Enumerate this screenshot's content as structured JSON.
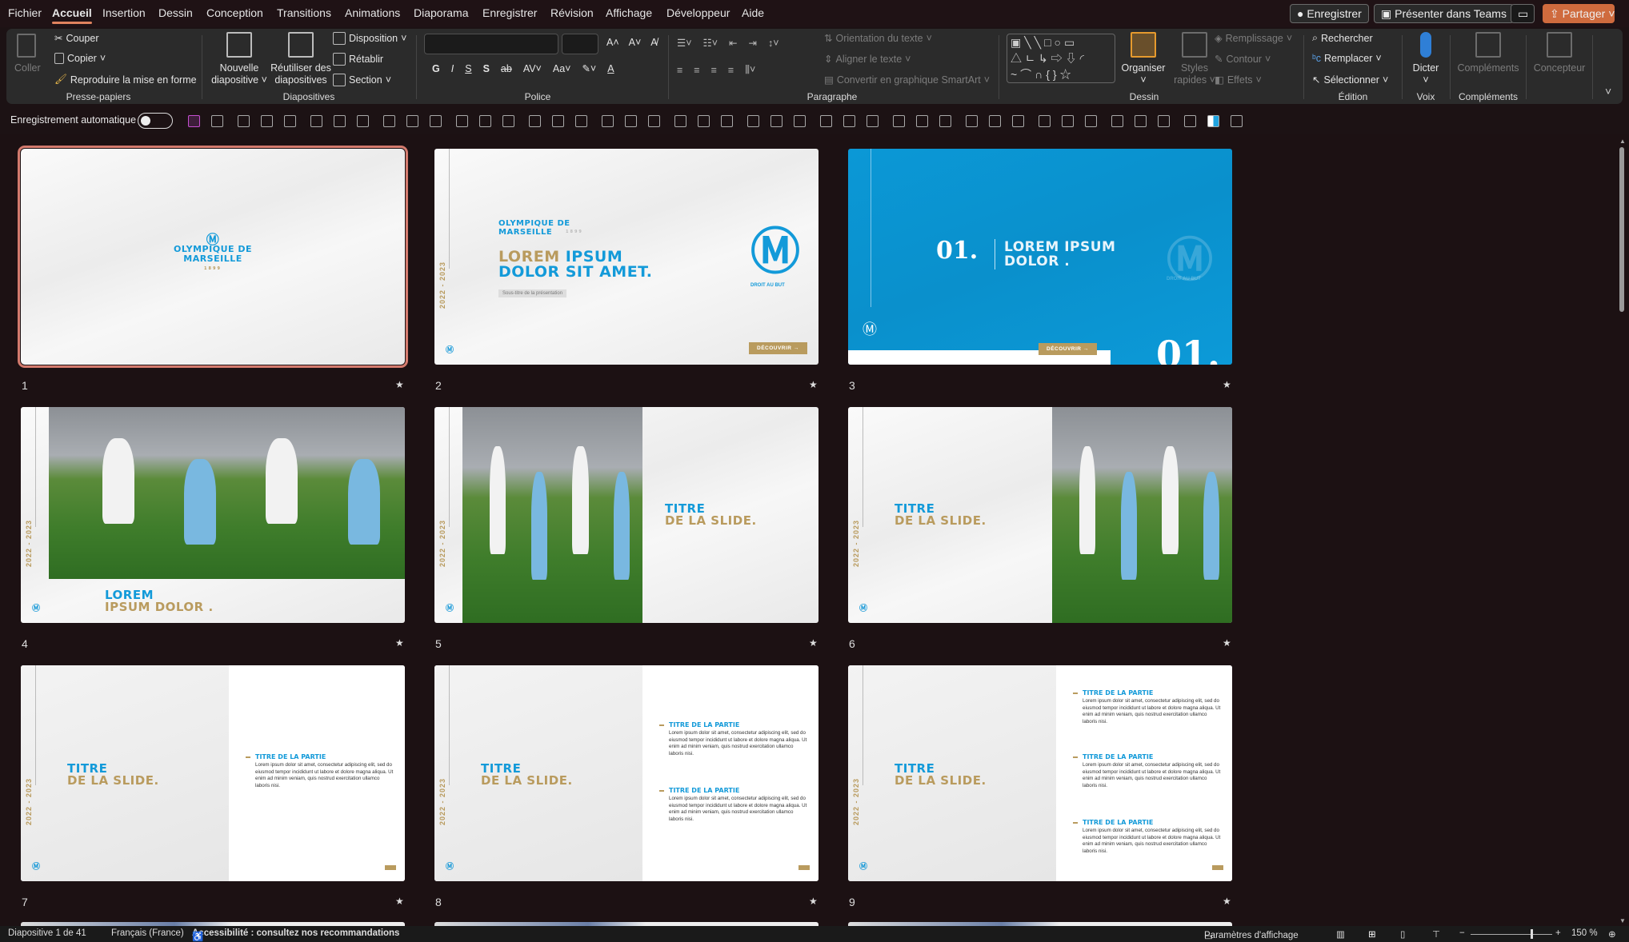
{
  "menu": [
    "Fichier",
    "Accueil",
    "Insertion",
    "Dessin",
    "Conception",
    "Transitions",
    "Animations",
    "Diaporama",
    "Enregistrer",
    "Révision",
    "Affichage",
    "Développeur",
    "Aide"
  ],
  "active_menu": "Accueil",
  "title_buttons": {
    "record": "Enregistrer",
    "teams": "Présenter dans Teams",
    "share": "Partager"
  },
  "colors": {
    "accent": "#e0835e",
    "share": "#cf6b3e",
    "om_blue": "#139ad9",
    "gold": "#b99b5e",
    "selection": "#d47b6e"
  },
  "ribbon": {
    "clipboard": {
      "paste": "Coller",
      "cut": "Couper",
      "copy": "Copier",
      "format_painter": "Reproduire la mise en forme",
      "label": "Presse-papiers"
    },
    "slides": {
      "new_slide": [
        "Nouvelle",
        "diapositive"
      ],
      "reuse": [
        "Réutiliser des",
        "diapositives"
      ],
      "layout": "Disposition",
      "reset": "Rétablir",
      "section": "Section",
      "label": "Diapositives"
    },
    "font": {
      "font_name": "",
      "font_size": "",
      "bold": "G",
      "italic": "I",
      "underline": "S",
      "shadow": "S",
      "label": "Police"
    },
    "paragraph": {
      "text_direction": "Orientation du texte",
      "align_text": "Aligner le texte",
      "smartart": "Convertir en graphique SmartArt",
      "label": "Paragraphe"
    },
    "drawing": {
      "arrange": "Organiser",
      "quick_styles": [
        "Styles",
        "rapides"
      ],
      "fill": "Remplissage",
      "outline": "Contour",
      "effects": "Effets",
      "label": "Dessin"
    },
    "editing": {
      "find": "Rechercher",
      "replace": "Remplacer",
      "select": "Sélectionner",
      "label": "Édition"
    },
    "voice": {
      "dictate": "Dicter",
      "label": "Voix"
    },
    "addins": {
      "addins": "Compléments",
      "label": "Compléments"
    },
    "designer": {
      "designer": "Concepteur"
    }
  },
  "qat": {
    "autosave": "Enregistrement automatique",
    "autosave_on": false
  },
  "slides": [
    {
      "n": "1",
      "type": "cover",
      "club": [
        "OLYMPIQUE DE",
        "MARSEILLE"
      ],
      "year": "1899"
    },
    {
      "n": "2",
      "type": "title",
      "club": [
        "OLYMPIQUE DE",
        "MARSEILLE"
      ],
      "year": "1899",
      "title_gold": "LOREM",
      "title_blue": "IPSUM",
      "title_line2": "DOLOR SIT AMET.",
      "subtitle": "Sous-titre de la présentation",
      "motto": "DROIT AU BUT",
      "button": "DÉCOUVRIR  →",
      "season": "2022 - 2023"
    },
    {
      "n": "3",
      "type": "section",
      "number": "01.",
      "title": [
        "LOREM IPSUM",
        "DOLOR ."
      ],
      "motto": "DROIT AU BUT",
      "button": "DÉCOUVRIR  →"
    },
    {
      "n": "4",
      "type": "photo-top",
      "title_blue": "LOREM",
      "title_gold": "IPSUM DOLOR .",
      "season": "2022 - 2023"
    },
    {
      "n": "5",
      "type": "photo-left",
      "title_blue": "TITRE",
      "title_gold": "DE LA SLIDE.",
      "season": "2022 - 2023"
    },
    {
      "n": "6",
      "type": "photo-right",
      "title_blue": "TITRE",
      "title_gold": "DE LA SLIDE.",
      "season": "2022 - 2023"
    },
    {
      "n": "7",
      "type": "text",
      "title_blue": "TITRE",
      "title_gold": "DE LA SLIDE.",
      "season": "2022 - 2023",
      "sections": 1
    },
    {
      "n": "8",
      "type": "text",
      "title_blue": "TITRE",
      "title_gold": "DE LA SLIDE.",
      "season": "2022 - 2023",
      "sections": 2
    },
    {
      "n": "9",
      "type": "text",
      "title_blue": "TITRE",
      "title_gold": "DE LA SLIDE.",
      "season": "2022 - 2023",
      "sections": 3
    }
  ],
  "section_heading": "TITRE DE LA PARTIE",
  "section_body": "Lorem ipsum dolor sit amet, consectetur adipiscing elit, sed do eiusmod tempor incididunt ut labore et dolore magna aliqua. Ut enim ad minim veniam, quis nostrud exercitation ullamco laboris nisi.",
  "status": {
    "slide": "Diapositive 1 de 41",
    "language": "Français (France)",
    "accessibility": "Accessibilité : consultez nos recommandations",
    "display_settings": "Paramètres d'affichage",
    "zoom": "150 %",
    "zoom_percent": 150
  }
}
